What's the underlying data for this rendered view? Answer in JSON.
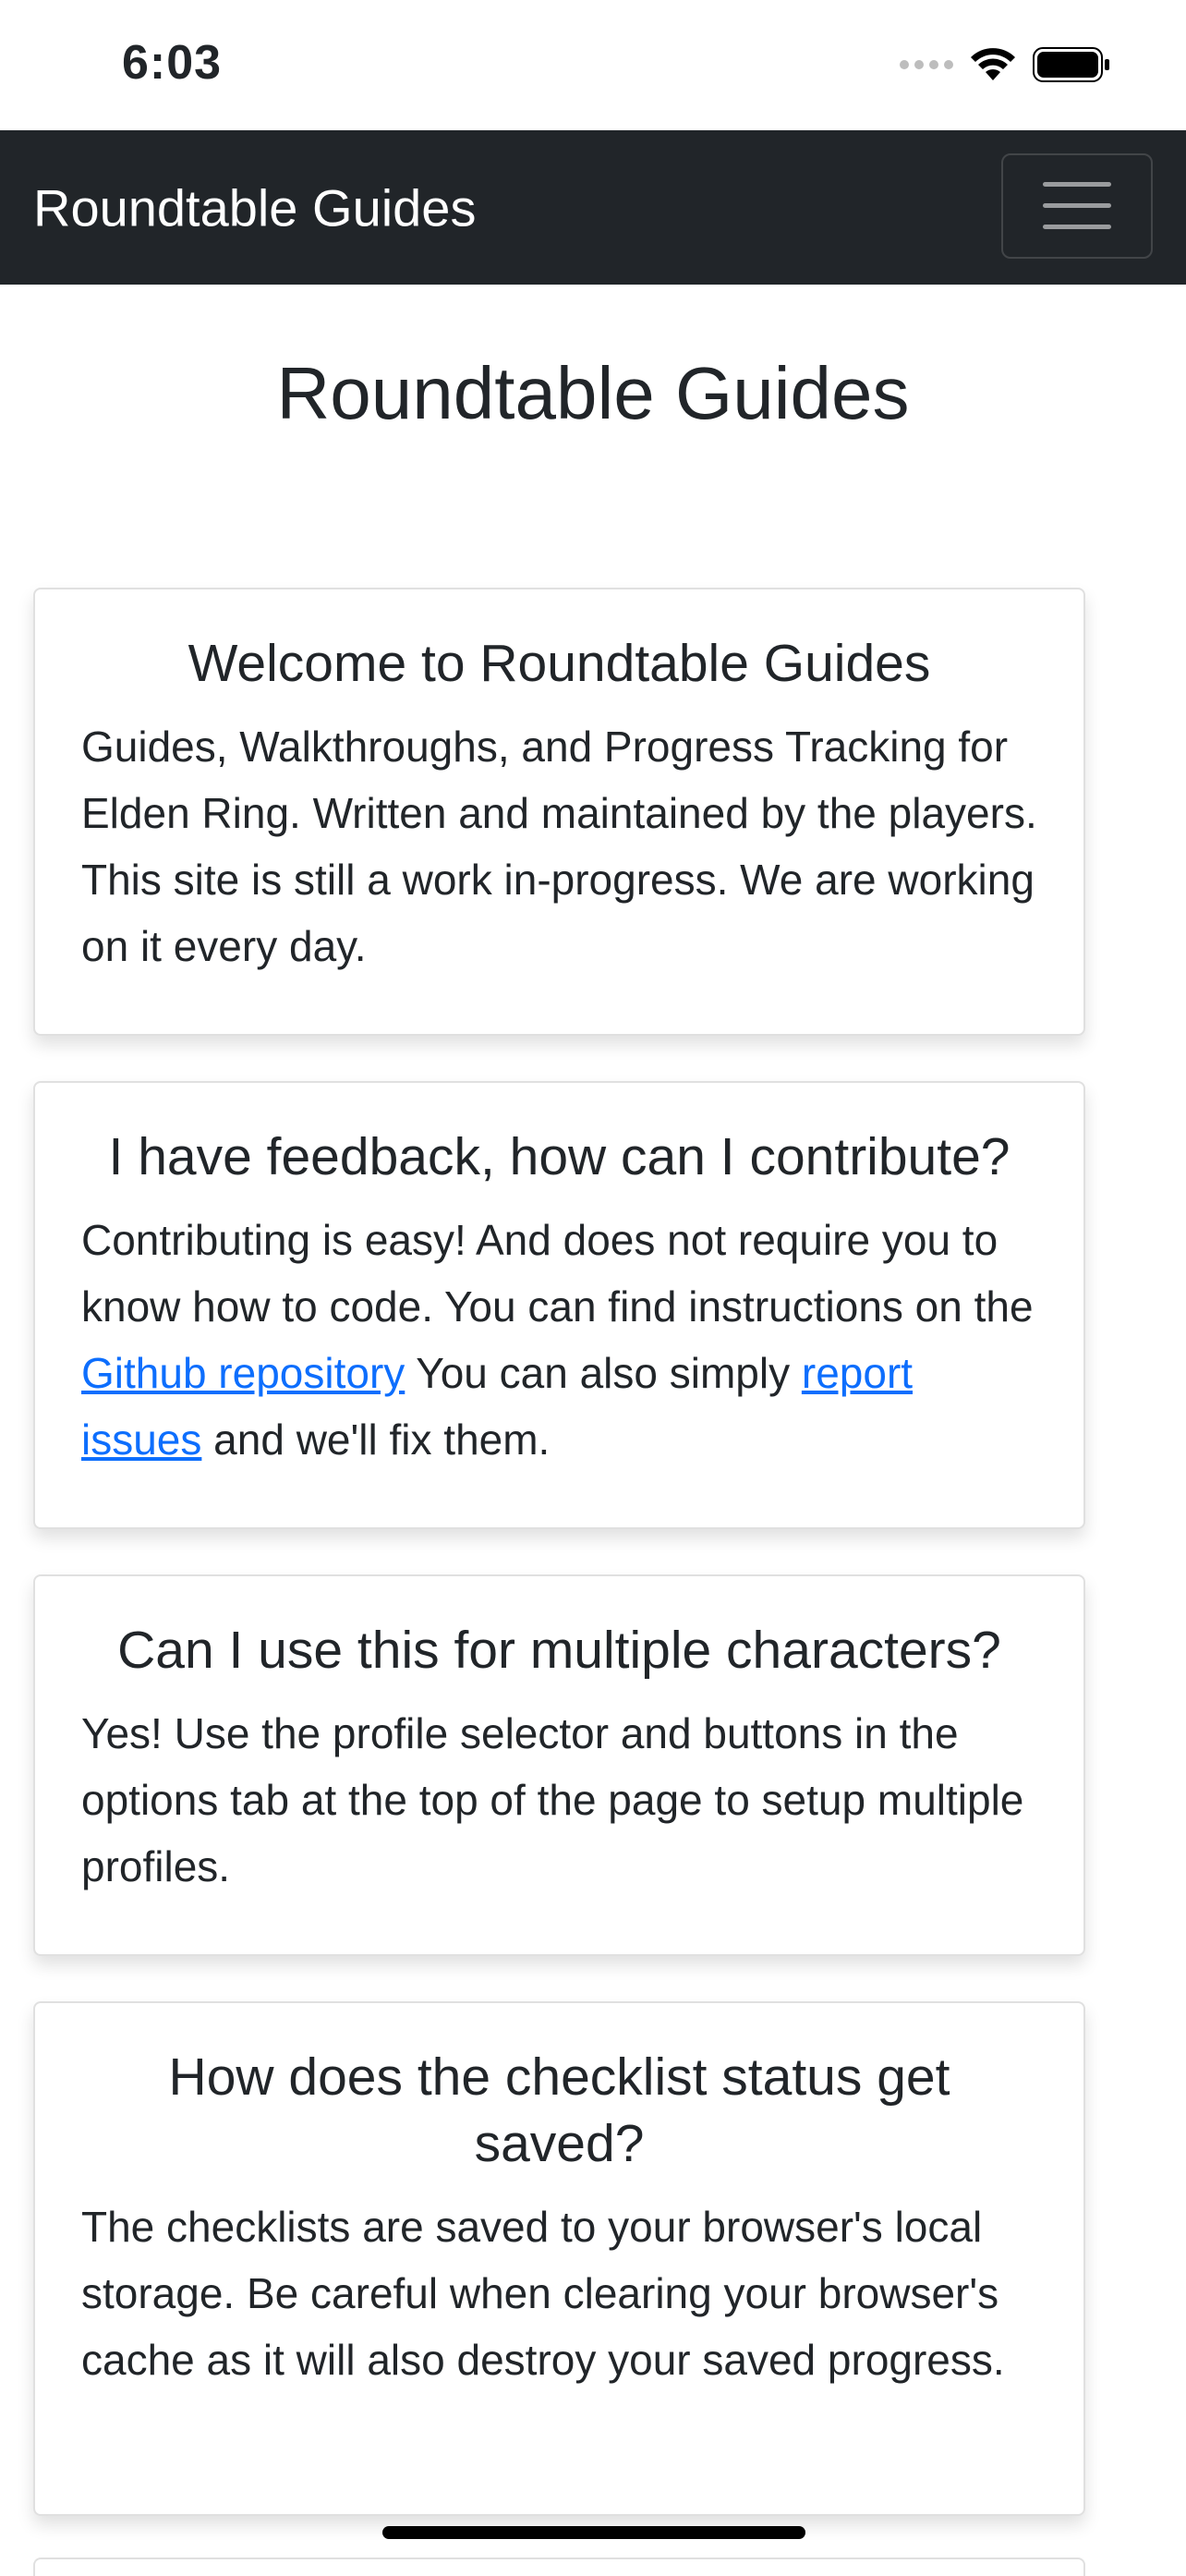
{
  "status_bar": {
    "time": "6:03"
  },
  "navbar": {
    "brand": "Roundtable Guides",
    "toggler_icon": "hamburger-menu-icon"
  },
  "page": {
    "title": "Roundtable Guides"
  },
  "cards": [
    {
      "title": "Welcome to Roundtable Guides",
      "body": "Guides, Walkthroughs, and Progress Tracking for Elden Ring. Written and maintained by the players. This site is still a work in-progress. We are working on it every day."
    },
    {
      "title": "I have feedback, how can I contribute?",
      "body_part1": "Contributing is easy! And does not require you to know how to code. You can find instructions on the ",
      "link1": "Github repository",
      "body_part2": " You can also simply ",
      "link2": "report issues",
      "body_part3": " and we'll fix them."
    },
    {
      "title": "Can I use this for multiple characters?",
      "body": "Yes! Use the profile selector and buttons in the options tab at the top of the page to setup multiple profiles."
    },
    {
      "title": "How does the checklist status get saved?",
      "body": "The checklists are saved to your browser's local storage. Be careful when clearing your browser's cache as it will also destroy your saved progress."
    }
  ],
  "colors": {
    "navbar_bg": "#212529",
    "link": "#0d6efd",
    "text": "#212529"
  }
}
